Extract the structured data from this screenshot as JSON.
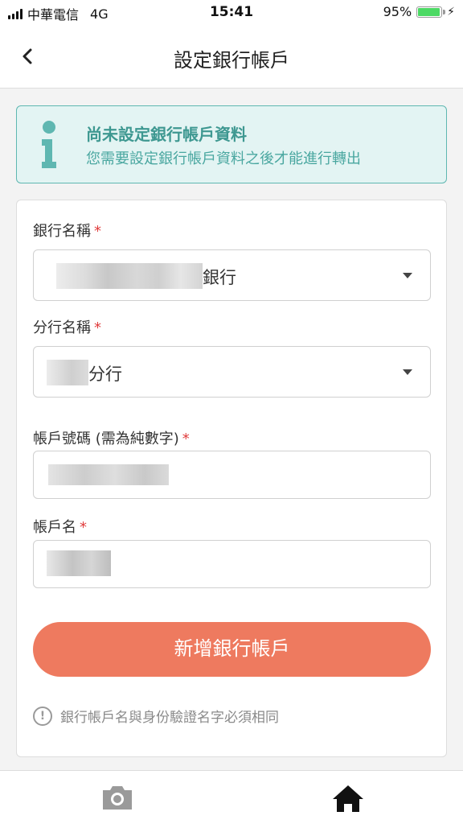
{
  "status_bar": {
    "carrier": "中華電信",
    "network": "4G",
    "time": "15:41",
    "battery": "95%",
    "battery_level": 0.95
  },
  "header": {
    "back_icon": "chevron-left-icon",
    "title": "設定銀行帳戶"
  },
  "notice": {
    "icon": "info-icon",
    "title": "尚未設定銀行帳戶資料",
    "description": "您需要設定銀行帳戶資料之後才能進行轉出"
  },
  "form": {
    "bank_name": {
      "label": "銀行名稱",
      "required_mark": "*",
      "value_suffix": "銀行"
    },
    "branch_name": {
      "label": "分行名稱",
      "required_mark": "*",
      "value_suffix": "分行"
    },
    "account_number": {
      "label": "帳戶號碼 (需為純數字)",
      "required_mark": "*"
    },
    "account_name": {
      "label": "帳戶名",
      "required_mark": "*"
    },
    "submit_label": "新增銀行帳戶",
    "hint": "銀行帳戶名與身份驗證名字必須相同",
    "hint_icon": "exclamation-circle-icon"
  },
  "bottom_nav": {
    "items": [
      {
        "icon": "camera-icon",
        "active": false
      },
      {
        "icon": "home-icon",
        "active": true
      }
    ]
  },
  "colors": {
    "accent": "#ee7a5f",
    "notice_bg": "#e3f4f3",
    "notice_text": "#3e9891",
    "required": "#e03c3c"
  }
}
